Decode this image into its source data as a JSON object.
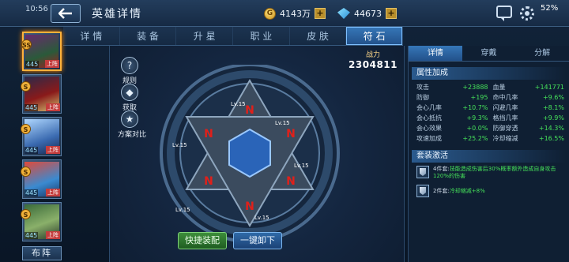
{
  "status": {
    "time": "10:56",
    "battery": "52%"
  },
  "header": {
    "title": "英雄详情",
    "gold": "4143万",
    "gems": "44673",
    "plus": "+"
  },
  "tabs": [
    "详 情",
    "装 备",
    "升 星",
    "职 业",
    "皮 肤",
    "符 石"
  ],
  "active_tab_index": 5,
  "hero_list": {
    "heroes": [
      {
        "level": "445",
        "tag": "上阵",
        "badge": "SS",
        "active": true
      },
      {
        "level": "445",
        "tag": "上阵",
        "badge": "S",
        "active": false
      },
      {
        "level": "445",
        "tag": "上阵",
        "badge": "S",
        "active": false
      },
      {
        "level": "445",
        "tag": "上阵",
        "badge": "S",
        "active": false
      },
      {
        "level": "445",
        "tag": "上阵",
        "badge": "S",
        "active": false
      }
    ],
    "formation_button": "布阵"
  },
  "center": {
    "side_buttons": [
      {
        "label": "规则",
        "icon": "question-icon",
        "glyph": "?"
      },
      {
        "label": "获取",
        "icon": "compass-icon",
        "glyph": "◆"
      },
      {
        "label": "方案对比",
        "icon": "star-icon",
        "glyph": "★"
      }
    ],
    "power_label": "战力",
    "power_value": "2304811",
    "rune_level": "Lv.15",
    "quick_equip": "快捷装配",
    "unequip_all": "一键卸下"
  },
  "right_panel": {
    "tabs": [
      "详情",
      "穿戴",
      "分解"
    ],
    "active_tab_index": 0,
    "attr_title": "属性加成",
    "attributes": [
      {
        "name": "攻击",
        "value": "+23888"
      },
      {
        "name": "血量",
        "value": "+141771"
      },
      {
        "name": "防御",
        "value": "+195"
      },
      {
        "name": "命中几率",
        "value": "+9.6%"
      },
      {
        "name": "会心几率",
        "value": "+10.7%"
      },
      {
        "name": "闪避几率",
        "value": "+8.1%"
      },
      {
        "name": "会心抵抗",
        "value": "+9.3%"
      },
      {
        "name": "格挡几率",
        "value": "+9.9%"
      },
      {
        "name": "会心效果",
        "value": "+0.0%"
      },
      {
        "name": "防御穿透",
        "value": "+14.3%"
      },
      {
        "name": "攻速加成",
        "value": "+25.2%"
      },
      {
        "name": "冷却缩减",
        "value": "+16.5%"
      }
    ],
    "set_title": "套装激活",
    "sets": [
      {
        "prefix": "4件套:",
        "effect": "技能造成伤害后30%概率额外造成自身攻击120%的伤害"
      },
      {
        "prefix": "2件套:",
        "effect": "冷却缩减+8%"
      }
    ]
  }
}
